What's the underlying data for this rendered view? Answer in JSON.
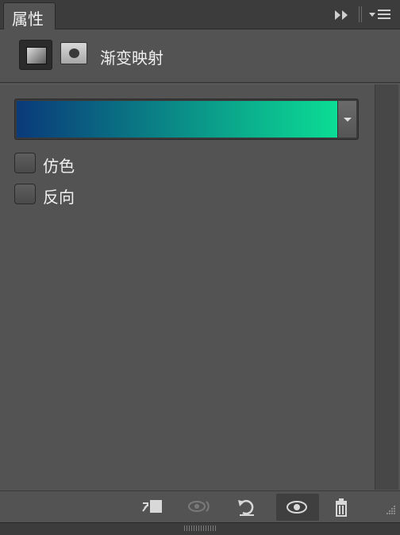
{
  "panel": {
    "tab_title": "属性",
    "adjustment_title": "渐变映射"
  },
  "gradient": {
    "colors": [
      "#0a3a7a",
      "#0bdd94"
    ],
    "start_color": "#0a3a7a",
    "end_color": "#0bdd94"
  },
  "options": [
    {
      "label": "仿色",
      "checked": false
    },
    {
      "label": "反向",
      "checked": false
    }
  ],
  "toolbar": {
    "icons": [
      "clip-to-layer-icon",
      "view-previous-state-icon",
      "reset-icon",
      "visibility-icon",
      "delete-icon"
    ]
  },
  "theme": {
    "panel_bg": "#535353",
    "title_bg": "#3c3c3c",
    "text": "#f0f0f0"
  }
}
